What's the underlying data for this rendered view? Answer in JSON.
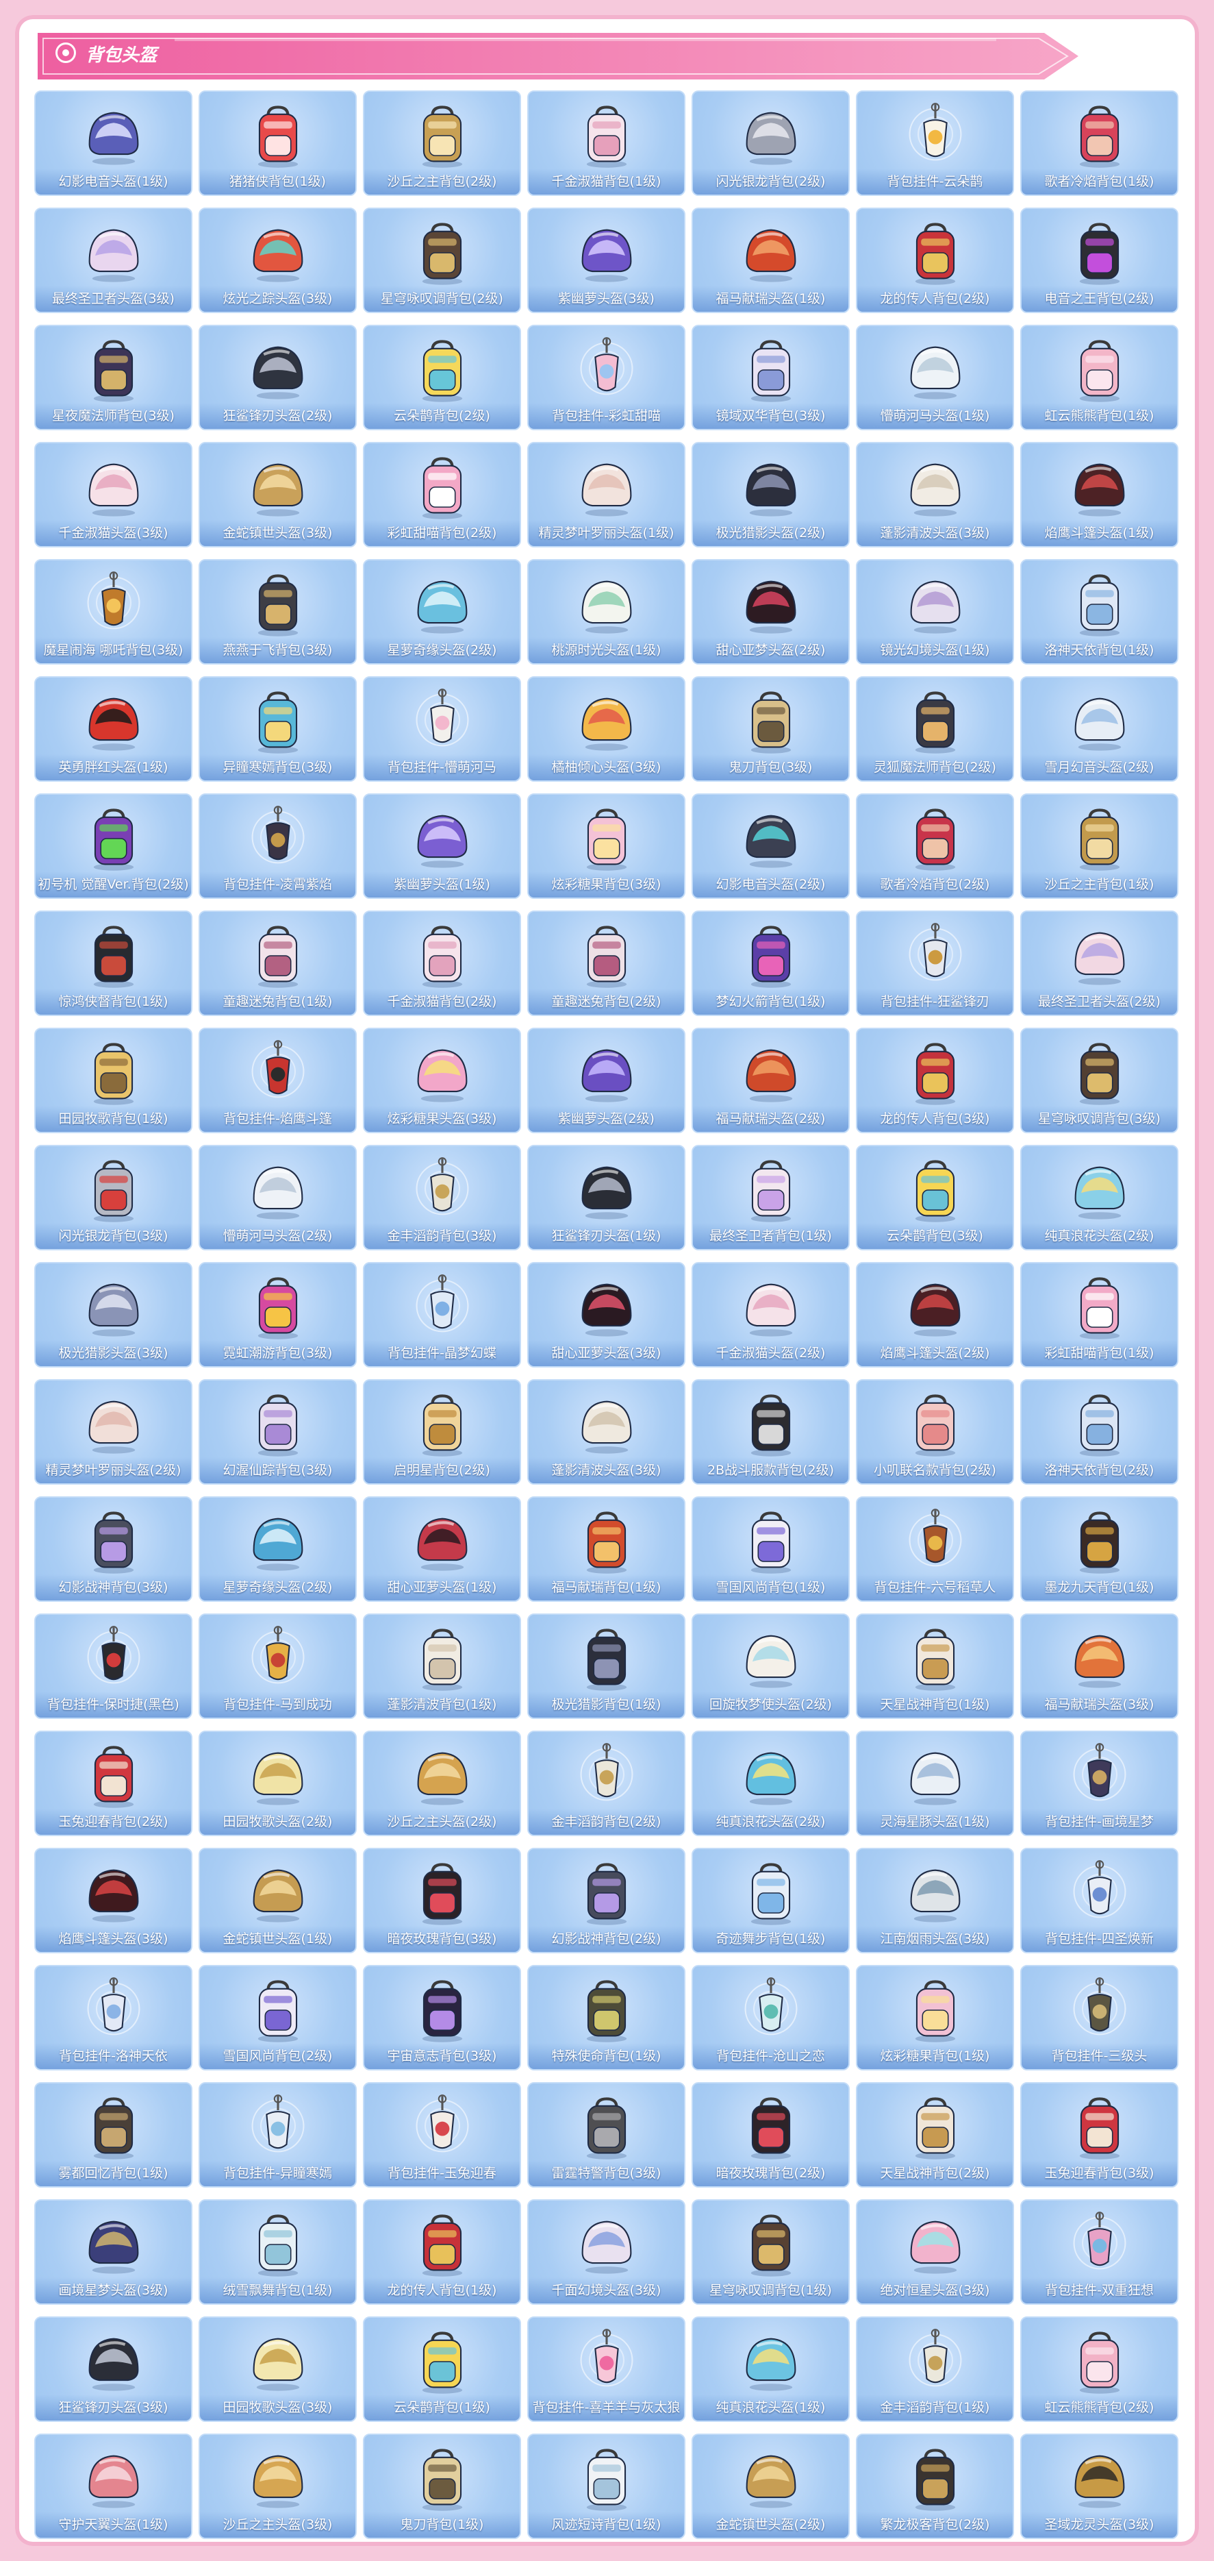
{
  "banner": {
    "title": "背包头盔"
  },
  "items": [
    {
      "label": "幻影电音头盔(1级)",
      "kind": "helmet",
      "color": "#5a5fb8",
      "accent": "#e0e4ff"
    },
    {
      "label": "猪猪侠背包(1级)",
      "kind": "bag",
      "color": "#e84a4a",
      "accent": "#ffe3e3"
    },
    {
      "label": "沙丘之主背包(2级)",
      "kind": "bag",
      "color": "#c8a054",
      "accent": "#f7e4b4"
    },
    {
      "label": "千金淑猫背包(1级)",
      "kind": "bag",
      "color": "#f6e4ec",
      "accent": "#e6a0bb"
    },
    {
      "label": "闪光银龙背包(2级)",
      "kind": "helmet",
      "color": "#9ea3b2",
      "accent": "#e8e9ee"
    },
    {
      "label": "背包挂件-云朵鹊",
      "kind": "charm",
      "color": "#f8f3e6",
      "accent": "#f2b842"
    },
    {
      "label": "歌者冷焰背包(1级)",
      "kind": "bag",
      "color": "#d8435a",
      "accent": "#f2c6b2"
    },
    {
      "label": "最终圣卫者头盔(3级)",
      "kind": "helmet",
      "color": "#e9d6ef",
      "accent": "#b6a2e6"
    },
    {
      "label": "炫光之踪头盔(3级)",
      "kind": "helmet",
      "color": "#e2563f",
      "accent": "#61d2c8"
    },
    {
      "label": "星穹咏叹调背包(2级)",
      "kind": "bag",
      "color": "#5a4536",
      "accent": "#d9b86c"
    },
    {
      "label": "紫幽萝头盔(3级)",
      "kind": "helmet",
      "color": "#6e55c8",
      "accent": "#d6c9ff"
    },
    {
      "label": "福马献瑞头盔(1级)",
      "kind": "helmet",
      "color": "#d54a2b",
      "accent": "#f2a46b"
    },
    {
      "label": "龙的传人背包(2级)",
      "kind": "bag",
      "color": "#c9343a",
      "accent": "#e9c45d"
    },
    {
      "label": "电音之王背包(2级)",
      "kind": "bag",
      "color": "#2d2d33",
      "accent": "#c34fdc"
    },
    {
      "label": "星夜魔法师背包(3级)",
      "kind": "bag",
      "color": "#3d3457",
      "accent": "#d4b26a"
    },
    {
      "label": "狂鲨锋刃头盔(2级)",
      "kind": "helmet",
      "color": "#2f3440",
      "accent": "#bfc6d6"
    },
    {
      "label": "云朵鹊背包(2级)",
      "kind": "bag",
      "color": "#f5d85a",
      "accent": "#67c6d8"
    },
    {
      "label": "背包挂件-彩虹甜喵",
      "kind": "charm",
      "color": "#f4bdd2",
      "accent": "#9ec5f0"
    },
    {
      "label": "镜域双华背包(3级)",
      "kind": "bag",
      "color": "#e9e3f4",
      "accent": "#8a9bd8"
    },
    {
      "label": "懵萌河马头盔(1级)",
      "kind": "helmet",
      "color": "#eef3f7",
      "accent": "#b8cbda"
    },
    {
      "label": "虹云熊熊背包(1级)",
      "kind": "bag",
      "color": "#f3b6c8",
      "accent": "#fbe6ee"
    },
    {
      "label": "千金淑猫头盔(3级)",
      "kind": "helmet",
      "color": "#f6e1e8",
      "accent": "#e6a6bd"
    },
    {
      "label": "金蛇镇世头盔(3级)",
      "kind": "helmet",
      "color": "#c9a15a",
      "accent": "#f4dca3"
    },
    {
      "label": "彩虹甜喵背包(2级)",
      "kind": "bag",
      "color": "#f3a8c6",
      "accent": "#ffffff"
    },
    {
      "label": "精灵梦叶罗丽头盔(1级)",
      "kind": "helmet",
      "color": "#f2e3dd",
      "accent": "#e4bfb5"
    },
    {
      "label": "极光猎影头盔(2级)",
      "kind": "helmet",
      "color": "#2c2f3d",
      "accent": "#8d94b3"
    },
    {
      "label": "蓬影清波头盔(3级)",
      "kind": "helmet",
      "color": "#f1ece4",
      "accent": "#d5c9b6"
    },
    {
      "label": "焰鹰斗篷头盔(1级)",
      "kind": "helmet",
      "color": "#4d2225",
      "accent": "#d54b4b"
    },
    {
      "label": "魔星闹海 哪吒背包(3级)",
      "kind": "charm",
      "color": "#c07b2b",
      "accent": "#f4c45a"
    },
    {
      "label": "燕燕于飞背包(3级)",
      "kind": "bag",
      "color": "#3e3e45",
      "accent": "#d7b36c"
    },
    {
      "label": "星萝奇缘头盔(2级)",
      "kind": "helmet",
      "color": "#6ac0df",
      "accent": "#e1f4fb"
    },
    {
      "label": "桃源时光头盔(1级)",
      "kind": "helmet",
      "color": "#f3f5ef",
      "accent": "#8fd0b2"
    },
    {
      "label": "甜心亚梦头盔(2级)",
      "kind": "helmet",
      "color": "#2d1b22",
      "accent": "#d8435f"
    },
    {
      "label": "镜光幻境头盔(1级)",
      "kind": "helmet",
      "color": "#e6e0ef",
      "accent": "#b39ad4"
    },
    {
      "label": "洛神天依背包(1级)",
      "kind": "bag",
      "color": "#dfe8f6",
      "accent": "#8bb6e2"
    },
    {
      "label": "英勇胖红头盔(1级)",
      "kind": "helmet",
      "color": "#d8362c",
      "accent": "#1a1a1a"
    },
    {
      "label": "异瞳寒嫣背包(3级)",
      "kind": "bag",
      "color": "#58b8d8",
      "accent": "#f4d87b"
    },
    {
      "label": "背包挂件-懵萌河马",
      "kind": "charm",
      "color": "#f2f0ec",
      "accent": "#f3b7cd"
    },
    {
      "label": "橘柚倾心头盔(3级)",
      "kind": "helmet",
      "color": "#f3b84a",
      "accent": "#e35a4a"
    },
    {
      "label": "鬼刀背包(3级)",
      "kind": "bag",
      "color": "#d9c08a",
      "accent": "#6b5a3e"
    },
    {
      "label": "灵狐魔法师背包(2级)",
      "kind": "bag",
      "color": "#3a3a44",
      "accent": "#e5b36a"
    },
    {
      "label": "雪月幻音头盔(2级)",
      "kind": "helmet",
      "color": "#e7eef6",
      "accent": "#9cc0e6"
    },
    {
      "label": "初号机 觉醒Ver.背包(2级)",
      "kind": "bag",
      "color": "#7a3fb4",
      "accent": "#63d655"
    },
    {
      "label": "背包挂件-凌霄紫焰",
      "kind": "charm",
      "color": "#3a3445",
      "accent": "#c49a4b"
    },
    {
      "label": "紫幽萝头盔(1级)",
      "kind": "helmet",
      "color": "#7b5fd2",
      "accent": "#d9cdff"
    },
    {
      "label": "炫彩糖果背包(3级)",
      "kind": "bag",
      "color": "#f4c2d6",
      "accent": "#fbe1a0"
    },
    {
      "label": "幻影电音头盔(2级)",
      "kind": "helmet",
      "color": "#3b4052",
      "accent": "#57d2d8"
    },
    {
      "label": "歌者冷焰背包(2级)",
      "kind": "bag",
      "color": "#c8344a",
      "accent": "#efc3a8"
    },
    {
      "label": "沙丘之主背包(1级)",
      "kind": "bag",
      "color": "#c29a4c",
      "accent": "#f2dba3"
    },
    {
      "label": "惊鸿侠督背包(1级)",
      "kind": "bag",
      "color": "#272a30",
      "accent": "#c94b3b"
    },
    {
      "label": "童趣迷兔背包(1级)",
      "kind": "bag",
      "color": "#f2e3ea",
      "accent": "#b36182"
    },
    {
      "label": "千金淑猫背包(2级)",
      "kind": "bag",
      "color": "#f6e4ec",
      "accent": "#e3a3bd"
    },
    {
      "label": "童趣迷兔背包(2级)",
      "kind": "bag",
      "color": "#eee0e6",
      "accent": "#b55c80"
    },
    {
      "label": "梦幻火箭背包(1级)",
      "kind": "bag",
      "color": "#5b3fa8",
      "accent": "#e863b8"
    },
    {
      "label": "背包挂件-狂鲨锋刃",
      "kind": "charm",
      "color": "#e5e8ef",
      "accent": "#cc9a40"
    },
    {
      "label": "最终圣卫者头盔(2级)",
      "kind": "helmet",
      "color": "#f2d8e3",
      "accent": "#b6a6e3"
    },
    {
      "label": "田园牧歌背包(1级)",
      "kind": "bag",
      "color": "#e9c46b",
      "accent": "#8a6b3b"
    },
    {
      "label": "背包挂件-焰鹰斗篷",
      "kind": "charm",
      "color": "#c8352f",
      "accent": "#2b2b2b"
    },
    {
      "label": "炫彩糖果头盔(3级)",
      "kind": "helmet",
      "color": "#f2a7c9",
      "accent": "#f7e07a"
    },
    {
      "label": "紫幽萝头盔(2级)",
      "kind": "helmet",
      "color": "#6a4fc2",
      "accent": "#c6b8ff"
    },
    {
      "label": "福马献瑞头盔(2级)",
      "kind": "helmet",
      "color": "#cf4a2a",
      "accent": "#f1a064"
    },
    {
      "label": "龙的传人背包(3级)",
      "kind": "bag",
      "color": "#c4323c",
      "accent": "#eac35a"
    },
    {
      "label": "星穹咏叹调背包(3级)",
      "kind": "bag",
      "color": "#523f32",
      "accent": "#ddbb6c"
    },
    {
      "label": "闪光银龙背包(3级)",
      "kind": "bag",
      "color": "#b6b9c4",
      "accent": "#d8403c"
    },
    {
      "label": "懵萌河马头盔(2级)",
      "kind": "helmet",
      "color": "#eef2f7",
      "accent": "#b8c8d8"
    },
    {
      "label": "金丰滔韵背包(3级)",
      "kind": "charm",
      "color": "#e8e4d6",
      "accent": "#c8a55a"
    },
    {
      "label": "狂鲨锋刃头盔(1级)",
      "kind": "helmet",
      "color": "#2a2d36",
      "accent": "#b5bccd"
    },
    {
      "label": "最终圣卫者背包(1级)",
      "kind": "bag",
      "color": "#f2e7ef",
      "accent": "#c9a3e8"
    },
    {
      "label": "云朵鹊背包(3级)",
      "kind": "bag",
      "color": "#f7d653",
      "accent": "#69c2d6"
    },
    {
      "label": "纯真浪花头盔(2级)",
      "kind": "helmet",
      "color": "#8ad0e8",
      "accent": "#f4dd7d"
    },
    {
      "label": "极光猎影头盔(3级)",
      "kind": "helmet",
      "color": "#8a94b6",
      "accent": "#e0e5f3"
    },
    {
      "label": "霓虹潮游背包(3级)",
      "kind": "bag",
      "color": "#d64aa0",
      "accent": "#f6c445"
    },
    {
      "label": "背包挂件-晶梦幻蝶",
      "kind": "charm",
      "color": "#dfeaf7",
      "accent": "#7fb0e5"
    },
    {
      "label": "甜心亚萝头盔(3级)",
      "kind": "helmet",
      "color": "#2a1a22",
      "accent": "#e0536b"
    },
    {
      "label": "千金淑猫头盔(2级)",
      "kind": "helmet",
      "color": "#f5e2e9",
      "accent": "#e6a7bf"
    },
    {
      "label": "焰鹰斗篷头盔(2级)",
      "kind": "helmet",
      "color": "#4b1f24",
      "accent": "#d04646"
    },
    {
      "label": "彩虹甜喵背包(1级)",
      "kind": "bag",
      "color": "#f2aac7",
      "accent": "#ffffff"
    },
    {
      "label": "精灵梦叶罗丽头盔(2级)",
      "kind": "helmet",
      "color": "#f1dfd9",
      "accent": "#e2b9ae"
    },
    {
      "label": "幻渥仙踪背包(3级)",
      "kind": "bag",
      "color": "#e6def0",
      "accent": "#a98ad6"
    },
    {
      "label": "启明星背包(2级)",
      "kind": "bag",
      "color": "#f0d49a",
      "accent": "#bf8c3d"
    },
    {
      "label": "蓬影清波头盔(3级)",
      "kind": "helmet",
      "color": "#efe9df",
      "accent": "#d1c3ae"
    },
    {
      "label": "2B战斗服款背包(2级)",
      "kind": "bag",
      "color": "#2c2c30",
      "accent": "#d8d8d8"
    },
    {
      "label": "小叽联名款背包(2级)",
      "kind": "bag",
      "color": "#f3c9c5",
      "accent": "#e58a8a"
    },
    {
      "label": "洛神天依背包(2级)",
      "kind": "bag",
      "color": "#dce6f5",
      "accent": "#86b1e0"
    },
    {
      "label": "幻影战神背包(3级)",
      "kind": "bag",
      "color": "#4a4e5e",
      "accent": "#b79be5"
    },
    {
      "label": "星萝奇缘头盔(2级)",
      "kind": "helmet",
      "color": "#4fa8d4",
      "accent": "#e1f3fb"
    },
    {
      "label": "甜心亚萝头盔(1级)",
      "kind": "helmet",
      "color": "#c43a4a",
      "accent": "#2a1a20"
    },
    {
      "label": "福马献瑞背包(1级)",
      "kind": "bag",
      "color": "#d24c2c",
      "accent": "#f3c16a"
    },
    {
      "label": "雪国风尚背包(1级)",
      "kind": "bag",
      "color": "#f0eef6",
      "accent": "#7d6ad8"
    },
    {
      "label": "背包挂件-六号稻草人",
      "kind": "charm",
      "color": "#a7572b",
      "accent": "#e8b84a"
    },
    {
      "label": "墨龙九天背包(1级)",
      "kind": "bag",
      "color": "#3a2a25",
      "accent": "#d6a442"
    },
    {
      "label": "背包挂件-保时捷(黑色)",
      "kind": "charm",
      "color": "#2a2a2e",
      "accent": "#d23c3c"
    },
    {
      "label": "背包挂件-马到成功",
      "kind": "charm",
      "color": "#e6b146",
      "accent": "#c84334"
    },
    {
      "label": "蓬影清波背包(1级)",
      "kind": "bag",
      "color": "#f1ece3",
      "accent": "#d3c4ad"
    },
    {
      "label": "极光猎影背包(1级)",
      "kind": "bag",
      "color": "#2c2f3c",
      "accent": "#8d93b4"
    },
    {
      "label": "回旋牧梦使头盔(2级)",
      "kind": "helmet",
      "color": "#f4f0e9",
      "accent": "#a7d9e8"
    },
    {
      "label": "天星战神背包(1级)",
      "kind": "bag",
      "color": "#f1e8dc",
      "accent": "#c99c53"
    },
    {
      "label": "福马献瑞头盔(3级)",
      "kind": "helmet",
      "color": "#e2733a",
      "accent": "#f6c87c"
    },
    {
      "label": "玉兔迎春背包(2级)",
      "kind": "bag",
      "color": "#d1383f",
      "accent": "#f2e3d2"
    },
    {
      "label": "田园牧歌头盔(2级)",
      "kind": "helmet",
      "color": "#f0e3a6",
      "accent": "#c9a24c"
    },
    {
      "label": "沙丘之主头盔(2级)",
      "kind": "helmet",
      "color": "#d5a34f",
      "accent": "#f3dba1"
    },
    {
      "label": "金丰滔韵背包(2级)",
      "kind": "charm",
      "color": "#ebe7da",
      "accent": "#c8a45a"
    },
    {
      "label": "纯真浪花头盔(2级)",
      "kind": "helmet",
      "color": "#62bfe0",
      "accent": "#f6e47c"
    },
    {
      "label": "灵海星豚头盔(1级)",
      "kind": "helmet",
      "color": "#eaf0f6",
      "accent": "#9db8d8"
    },
    {
      "label": "背包挂件-画境星梦",
      "kind": "charm",
      "color": "#3f3a5a",
      "accent": "#c8a463"
    },
    {
      "label": "焰鹰斗篷头盔(3级)",
      "kind": "helmet",
      "color": "#3f1a1e",
      "accent": "#d84444"
    },
    {
      "label": "金蛇镇世头盔(1级)",
      "kind": "helmet",
      "color": "#c59c52",
      "accent": "#f2d99c"
    },
    {
      "label": "暗夜玫瑰背包(3级)",
      "kind": "bag",
      "color": "#2b2227",
      "accent": "#e04c5a"
    },
    {
      "label": "幻影战神背包(2级)",
      "kind": "bag",
      "color": "#474b5c",
      "accent": "#b49ae6"
    },
    {
      "label": "奇迹舞步背包(1级)",
      "kind": "bag",
      "color": "#e6eef8",
      "accent": "#7fb6e8"
    },
    {
      "label": "江南烟雨头盔(3级)",
      "kind": "helmet",
      "color": "#dfe4e8",
      "accent": "#7f9bb0"
    },
    {
      "label": "背包挂件-四圣焕新",
      "kind": "charm",
      "color": "#e9eef6",
      "accent": "#6d8fd3"
    },
    {
      "label": "背包挂件-洛神天依",
      "kind": "charm",
      "color": "#e3e9f6",
      "accent": "#8cb4e6"
    },
    {
      "label": "雪国风尚背包(2级)",
      "kind": "bag",
      "color": "#eeeaf6",
      "accent": "#7a66d3"
    },
    {
      "label": "宇宙意志背包(3级)",
      "kind": "bag",
      "color": "#2a2440",
      "accent": "#b48be6"
    },
    {
      "label": "特殊使命背包(1级)",
      "kind": "bag",
      "color": "#4e4c38",
      "accent": "#cfc66d"
    },
    {
      "label": "背包挂件-沧山之恋",
      "kind": "charm",
      "color": "#d8eef2",
      "accent": "#5fbdb2"
    },
    {
      "label": "炫彩糖果背包(1级)",
      "kind": "bag",
      "color": "#f2c1d4",
      "accent": "#f9de98"
    },
    {
      "label": "背包挂件-三级头",
      "kind": "charm",
      "color": "#5b5642",
      "accent": "#c9b173"
    },
    {
      "label": "雾都回忆背包(1级)",
      "kind": "bag",
      "color": "#4a4038",
      "accent": "#c6a670"
    },
    {
      "label": "背包挂件-异瞳寒嫣",
      "kind": "charm",
      "color": "#e8eef6",
      "accent": "#8ac0e4"
    },
    {
      "label": "背包挂件-玉兔迎春",
      "kind": "charm",
      "color": "#f3ece6",
      "accent": "#d8474e"
    },
    {
      "label": "雷霆特警背包(3级)",
      "kind": "bag",
      "color": "#4f4f52",
      "accent": "#a9a9ad"
    },
    {
      "label": "暗夜玫瑰背包(2级)",
      "kind": "bag",
      "color": "#2d2328",
      "accent": "#e04c5a"
    },
    {
      "label": "天星战神背包(2级)",
      "kind": "bag",
      "color": "#f0e6d8",
      "accent": "#c79a51"
    },
    {
      "label": "玉兔迎春背包(3级)",
      "kind": "bag",
      "color": "#cf3640",
      "accent": "#f3e4d3"
    },
    {
      "label": "画境星梦头盔(3级)",
      "kind": "helmet",
      "color": "#3b3f7a",
      "accent": "#d1b56e"
    },
    {
      "label": "绒雪飘舞背包(1级)",
      "kind": "bag",
      "color": "#e7f1f6",
      "accent": "#92c5da"
    },
    {
      "label": "龙的传人背包(1级)",
      "kind": "bag",
      "color": "#c73139",
      "accent": "#e8c15a"
    },
    {
      "label": "千面幻境头盔(3级)",
      "kind": "helmet",
      "color": "#e9e1f0",
      "accent": "#8aa1df"
    },
    {
      "label": "星穹咏叹调背包(1级)",
      "kind": "bag",
      "color": "#574133",
      "accent": "#dcb96b"
    },
    {
      "label": "绝对恒星头盔(3级)",
      "kind": "helmet",
      "color": "#f2b3cc",
      "accent": "#9de3e6"
    },
    {
      "label": "背包挂件-双重狂想",
      "kind": "charm",
      "color": "#e8a2c6",
      "accent": "#7bb8e2"
    },
    {
      "label": "狂鲨锋刃头盔(3级)",
      "kind": "helmet",
      "color": "#2b2e38",
      "accent": "#c3c9d8"
    },
    {
      "label": "田园牧歌头盔(3级)",
      "kind": "helmet",
      "color": "#f3e7b0",
      "accent": "#c7a04a"
    },
    {
      "label": "云朵鹊背包(1级)",
      "kind": "bag",
      "color": "#f6d654",
      "accent": "#6bc3d7"
    },
    {
      "label": "背包挂件-喜羊羊与灰太狼",
      "kind": "charm",
      "color": "#f7c7d8",
      "accent": "#ef6aa1"
    },
    {
      "label": "纯真浪花头盔(1级)",
      "kind": "helmet",
      "color": "#6cc4e2",
      "accent": "#f5e07c"
    },
    {
      "label": "金丰滔韵背包(1级)",
      "kind": "charm",
      "color": "#ebe8dc",
      "accent": "#c6a35a"
    },
    {
      "label": "虹云熊熊背包(2级)",
      "kind": "bag",
      "color": "#f2b2c6",
      "accent": "#fbe5ed"
    },
    {
      "label": "守护天翼头盔(1级)",
      "kind": "helmet",
      "color": "#e4858f",
      "accent": "#f7dbe0"
    },
    {
      "label": "沙丘之主头盔(3级)",
      "kind": "helmet",
      "color": "#d6a652",
      "accent": "#f4dda4"
    },
    {
      "label": "鬼刀背包(1级)",
      "kind": "bag",
      "color": "#e2cf9e",
      "accent": "#6c5b3f"
    },
    {
      "label": "风迹短诗背包(1级)",
      "kind": "bag",
      "color": "#f0f3f6",
      "accent": "#a4c4dc"
    },
    {
      "label": "金蛇镇世头盔(2级)",
      "kind": "helmet",
      "color": "#c79e54",
      "accent": "#f1d79a"
    },
    {
      "label": "繁龙极客背包(2级)",
      "kind": "bag",
      "color": "#3a3430",
      "accent": "#c9a25a"
    },
    {
      "label": "圣域龙灵头盔(3级)",
      "kind": "helmet",
      "color": "#c79a45",
      "accent": "#2e2a26"
    }
  ]
}
